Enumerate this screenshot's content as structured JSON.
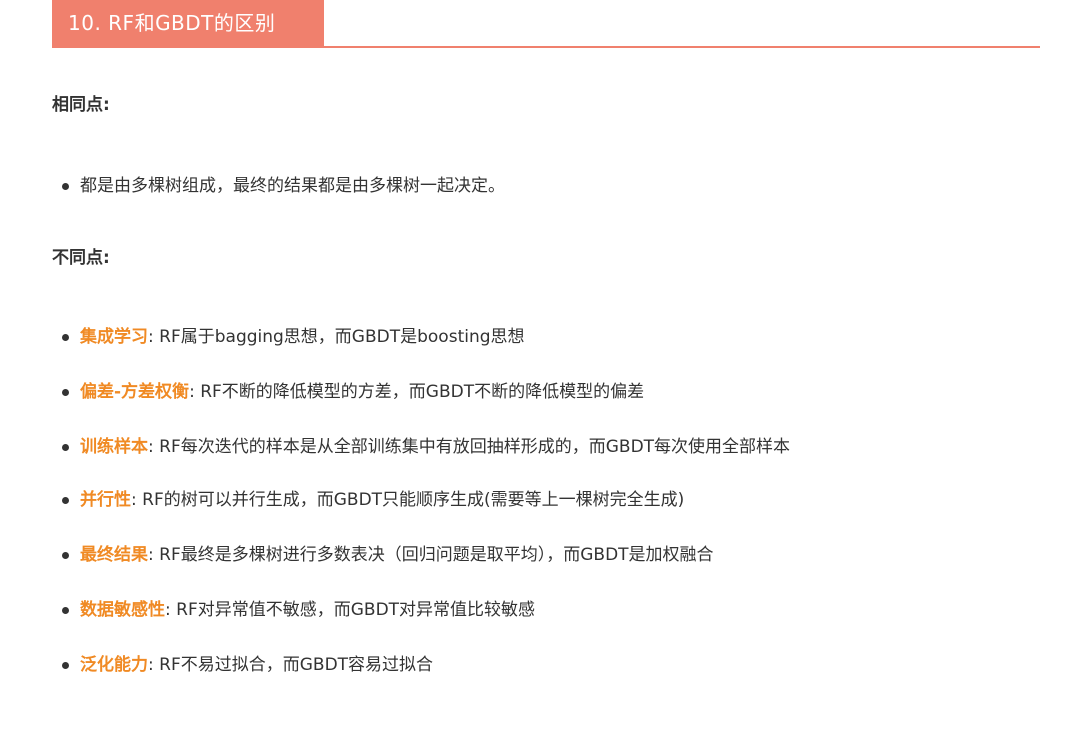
{
  "heading": {
    "title": "10. RF和GBDT的区别"
  },
  "same": {
    "label": "相同点:",
    "items": [
      "都是由多棵树组成，最终的结果都是由多棵树一起决定。"
    ]
  },
  "different": {
    "label": "不同点:",
    "items": [
      {
        "key": "集成学习",
        "sep": ": ",
        "text": "RF属于bagging思想，而GBDT是boosting思想"
      },
      {
        "key": "偏差-方差权衡",
        "sep": ": ",
        "text": "RF不断的降低模型的方差，而GBDT不断的降低模型的偏差"
      },
      {
        "key": "训练样本",
        "sep": ": ",
        "text": "RF每次迭代的样本是从全部训练集中有放回抽样形成的，而GBDT每次使用全部样本"
      },
      {
        "key": "并行性",
        "sep": ": ",
        "text": "RF的树可以并行生成，而GBDT只能顺序生成(需要等上一棵树完全生成)"
      },
      {
        "key": "最终结果",
        "sep": ": ",
        "text": "RF最终是多棵树进行多数表决（回归问题是取平均），而GBDT是加权融合"
      },
      {
        "key": "数据敏感性",
        "sep": ": ",
        "text": "RF对异常值不敏感，而GBDT对异常值比较敏感"
      },
      {
        "key": "泛化能力",
        "sep": ": ",
        "text": "RF不易过拟合，而GBDT容易过拟合"
      }
    ]
  },
  "colors": {
    "heading_bg": "#f0806d",
    "key_text": "#f08a24",
    "body_text": "#333333"
  }
}
